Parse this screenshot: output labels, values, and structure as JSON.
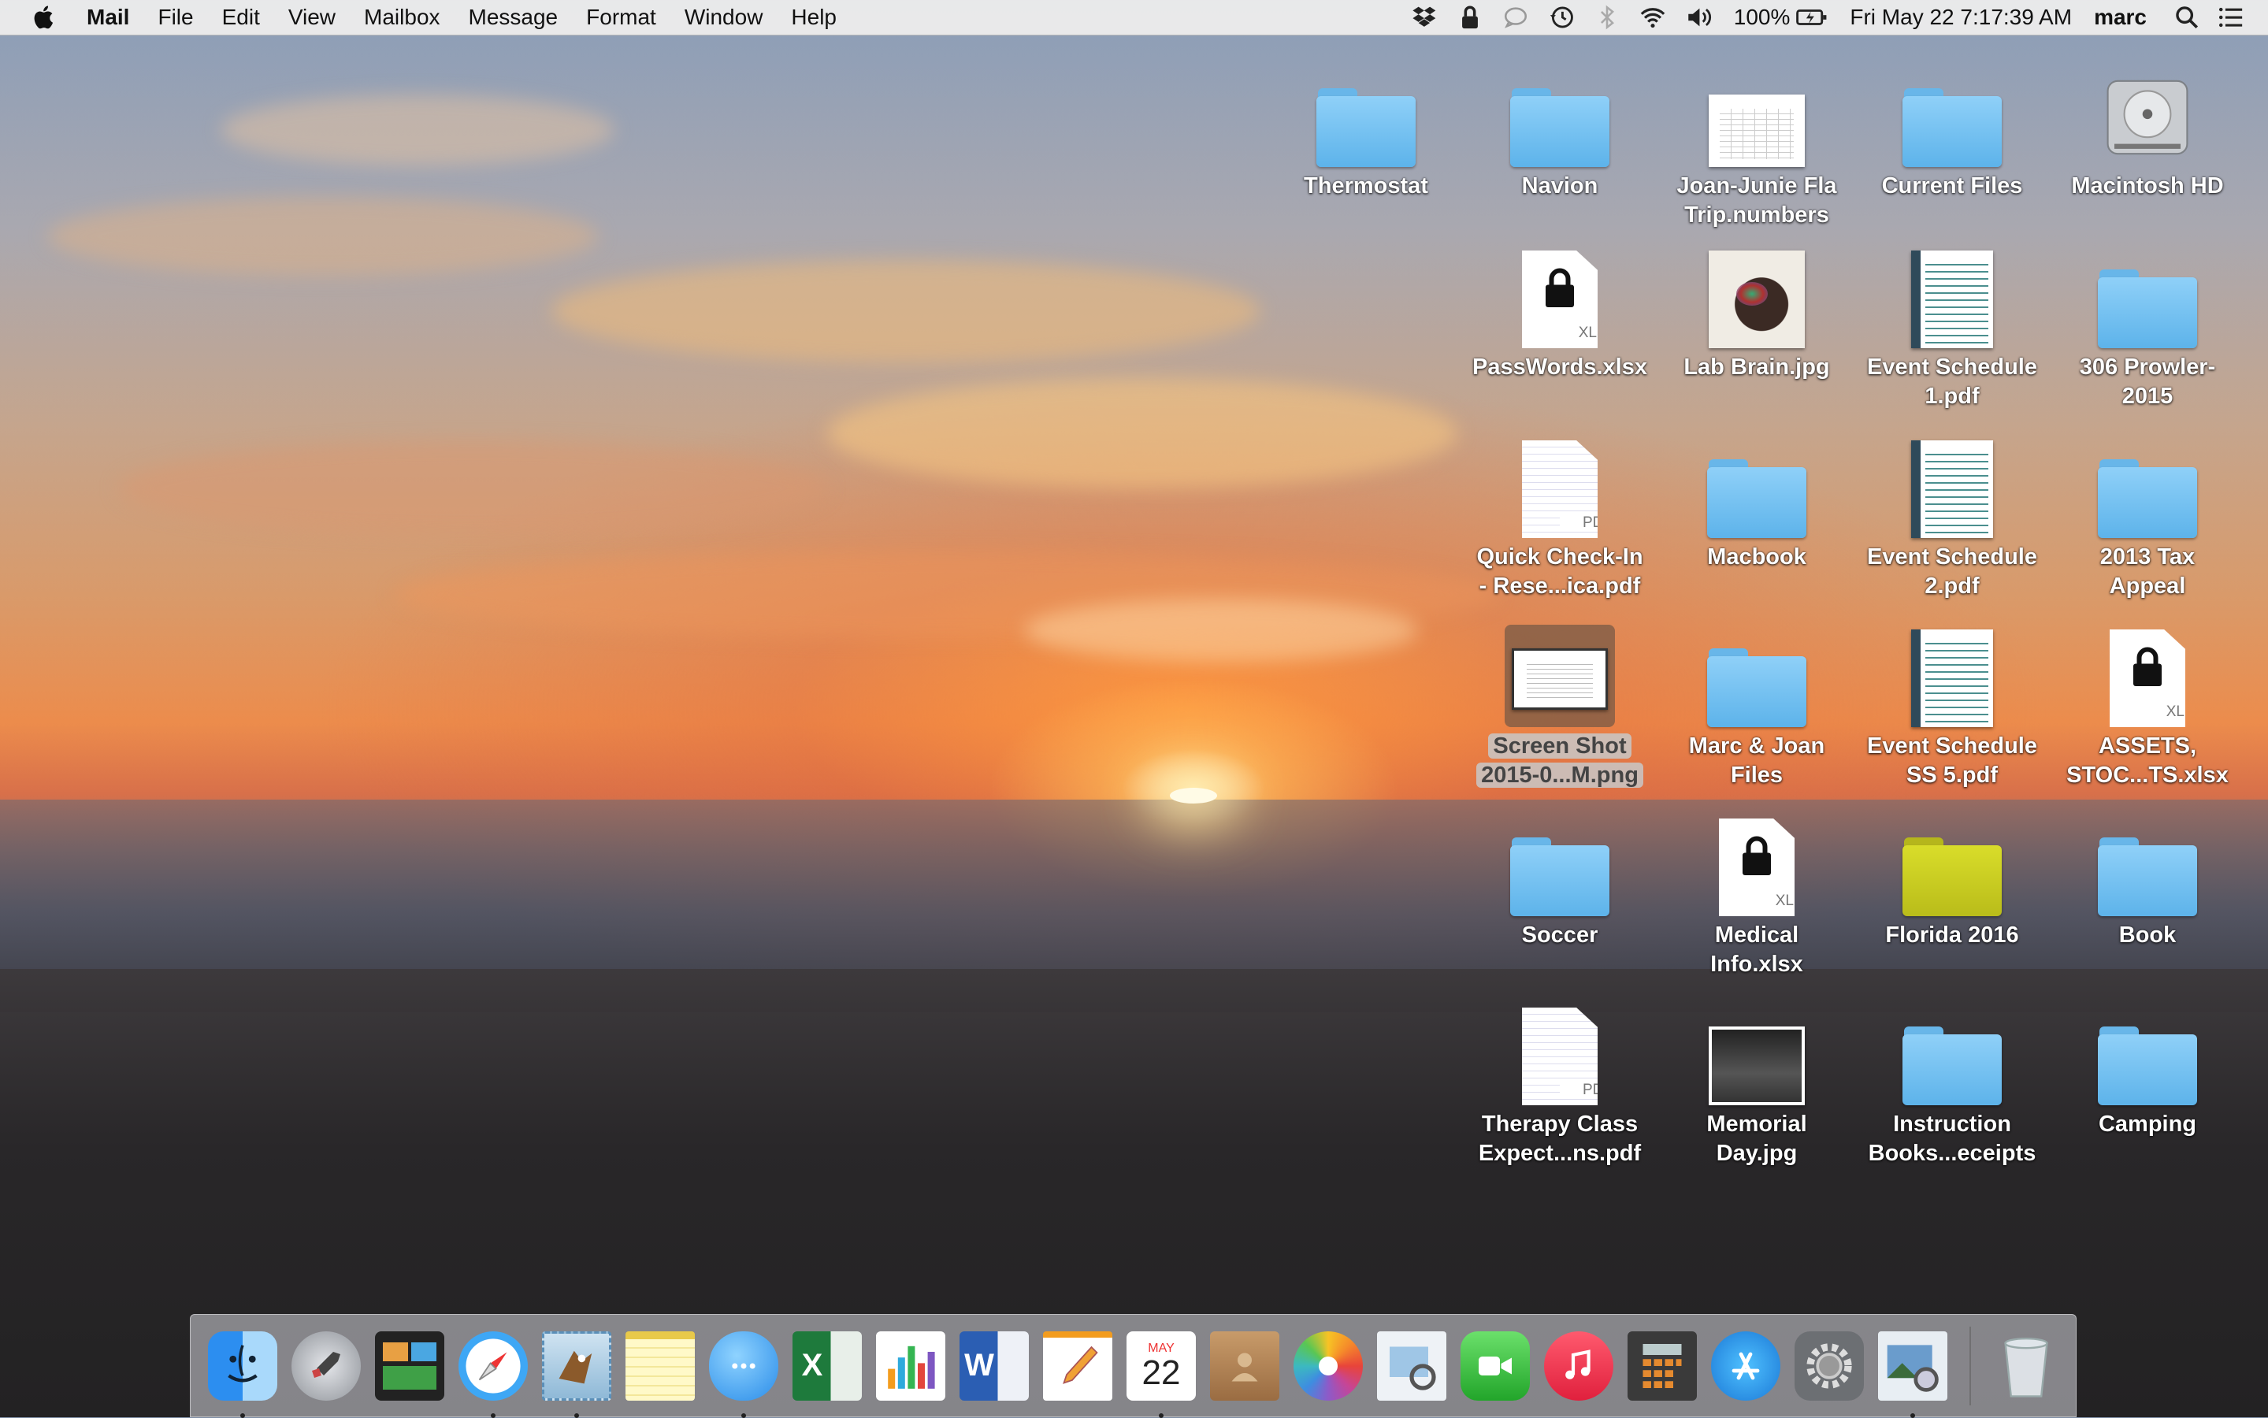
{
  "menubar": {
    "app_name": "Mail",
    "menus": [
      "File",
      "Edit",
      "View",
      "Mailbox",
      "Message",
      "Format",
      "Window",
      "Help"
    ],
    "battery": "100%",
    "clock": "Fri May 22  7:17:39 AM",
    "user": "marc"
  },
  "desktop": {
    "icons": [
      {
        "label": "Thermostat",
        "kind": "folder"
      },
      {
        "label": "Navion",
        "kind": "folder"
      },
      {
        "label": "Joan-Junie Fla\nTrip.numbers",
        "kind": "spreadsheet-thumb"
      },
      {
        "label": "Current Files",
        "kind": "folder"
      },
      {
        "label": "Macintosh HD",
        "kind": "hard-drive"
      },
      {
        "label": "PassWords.xlsx",
        "kind": "locked-xlsx",
        "badge": "XLSX"
      },
      {
        "label": "Lab Brain.jpg",
        "kind": "image-thumb"
      },
      {
        "label": "Event Schedule\n1.pdf",
        "kind": "pdf-thumb"
      },
      {
        "label": "306 Prowler-\n2015",
        "kind": "folder"
      },
      {
        "label": "Quick Check-In\n- Rese...ica.pdf",
        "kind": "pdf-doc",
        "badge": "PDF"
      },
      {
        "label": "Macbook",
        "kind": "folder"
      },
      {
        "label": "Event Schedule\n2.pdf",
        "kind": "pdf-thumb"
      },
      {
        "label": "2013 Tax\nAppeal",
        "kind": "folder"
      },
      {
        "label": "Screen Shot\n2015-0...M.png",
        "kind": "screenshot",
        "selected": true
      },
      {
        "label": "Marc & Joan\nFiles",
        "kind": "folder"
      },
      {
        "label": "Event Schedule\nSS 5.pdf",
        "kind": "pdf-thumb"
      },
      {
        "label": "ASSETS,\nSTOC...TS.xlsx",
        "kind": "locked-xlsx",
        "badge": "XLSX"
      },
      {
        "label": "Soccer",
        "kind": "folder"
      },
      {
        "label": "Medical\nInfo.xlsx",
        "kind": "locked-xlsx",
        "badge": "XLSX"
      },
      {
        "label": "Florida 2016",
        "kind": "folder-yellow"
      },
      {
        "label": "Book",
        "kind": "folder"
      },
      {
        "label": "Therapy Class\nExpect...ns.pdf",
        "kind": "pdf-doc",
        "badge": "PDF"
      },
      {
        "label": "Memorial\nDay.jpg",
        "kind": "image-thumb-dark"
      },
      {
        "label": "Instruction\nBooks...eceipts",
        "kind": "folder"
      },
      {
        "label": "Camping",
        "kind": "folder"
      }
    ]
  },
  "dock": {
    "calendar_month": "MAY",
    "calendar_day": "22",
    "excel_letter": "X",
    "word_letter": "W",
    "apps": [
      {
        "name": "finder-icon",
        "running": true
      },
      {
        "name": "launchpad-icon",
        "running": false
      },
      {
        "name": "mission-control-icon",
        "running": false
      },
      {
        "name": "safari-icon",
        "running": true
      },
      {
        "name": "mail-icon",
        "running": true
      },
      {
        "name": "notes-icon",
        "running": false
      },
      {
        "name": "messages-icon",
        "running": true
      },
      {
        "name": "excel-icon",
        "running": false
      },
      {
        "name": "numbers-icon",
        "running": false
      },
      {
        "name": "word-icon",
        "running": false
      },
      {
        "name": "pages-icon",
        "running": false
      },
      {
        "name": "calendar-icon",
        "running": true
      },
      {
        "name": "contacts-icon",
        "running": false
      },
      {
        "name": "photos-icon",
        "running": false
      },
      {
        "name": "preview-icon",
        "running": false
      },
      {
        "name": "facetime-icon",
        "running": false
      },
      {
        "name": "itunes-icon",
        "running": false
      },
      {
        "name": "calculator-icon",
        "running": false
      },
      {
        "name": "app-store-icon",
        "running": false
      },
      {
        "name": "system-preferences-icon",
        "running": false
      },
      {
        "name": "image-capture-icon",
        "running": true
      },
      {
        "name": "trash-icon",
        "running": false
      }
    ]
  },
  "colors": {
    "folder_blue": "#6cbdf0",
    "folder_yellow": "#cfd224",
    "menubar_bg": "#ececec"
  }
}
